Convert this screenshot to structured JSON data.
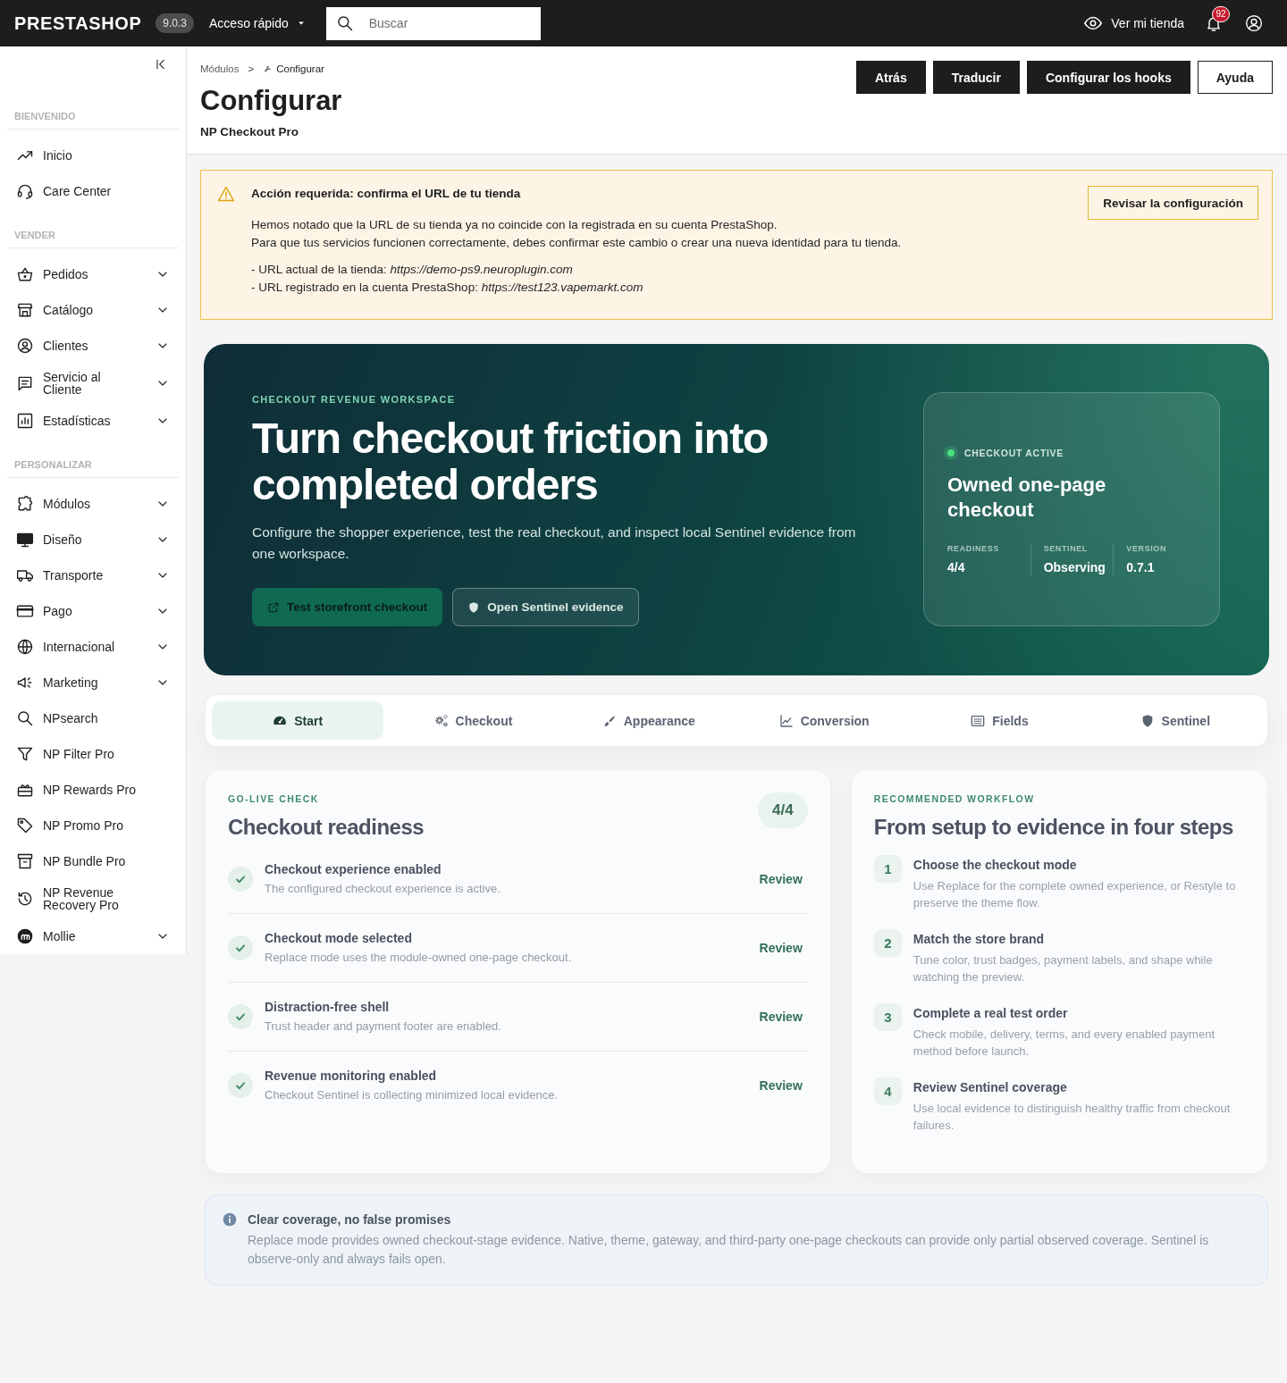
{
  "topbar": {
    "logo": "PRESTASHOP",
    "version": "9.0.3",
    "quick_access": "Acceso rápido",
    "search": {
      "placeholder": "Buscar"
    },
    "view_store": "Ver mi tienda",
    "notifications": "92"
  },
  "sidebar": {
    "sections": [
      {
        "title": "BIENVENIDO",
        "items": [
          {
            "label": "Inicio",
            "has_submenu": false
          },
          {
            "label": "Care Center",
            "has_submenu": false
          }
        ]
      },
      {
        "title": "VENDER",
        "items": [
          {
            "label": "Pedidos",
            "has_submenu": true
          },
          {
            "label": "Catálogo",
            "has_submenu": true
          },
          {
            "label": "Clientes",
            "has_submenu": true
          },
          {
            "label": "Servicio al Cliente",
            "has_submenu": true
          },
          {
            "label": "Estadísticas",
            "has_submenu": true
          }
        ]
      },
      {
        "title": "PERSONALIZAR",
        "items": [
          {
            "label": "Módulos",
            "has_submenu": true
          },
          {
            "label": "Diseño",
            "has_submenu": true
          },
          {
            "label": "Transporte",
            "has_submenu": true
          },
          {
            "label": "Pago",
            "has_submenu": true
          },
          {
            "label": "Internacional",
            "has_submenu": true
          },
          {
            "label": "Marketing",
            "has_submenu": true
          },
          {
            "label": "NPsearch",
            "has_submenu": false
          },
          {
            "label": "NP Filter Pro",
            "has_submenu": false
          },
          {
            "label": "NP Rewards Pro",
            "has_submenu": false
          },
          {
            "label": "NP Promo Pro",
            "has_submenu": false
          },
          {
            "label": "NP Bundle Pro",
            "has_submenu": false
          },
          {
            "label": "NP Revenue Recovery Pro",
            "has_submenu": false
          },
          {
            "label": "Mollie",
            "has_submenu": true
          }
        ]
      }
    ]
  },
  "header": {
    "breadcrumb": {
      "parent": "Módulos",
      "separator": ">",
      "current": "Configurar"
    },
    "title": "Configurar",
    "subtitle": "NP Checkout Pro",
    "buttons": [
      {
        "label": "Atrás",
        "kind": "dark"
      },
      {
        "label": "Traducir",
        "kind": "dark"
      },
      {
        "label": "Configurar los hooks",
        "kind": "dark"
      },
      {
        "label": "Ayuda",
        "kind": "outline"
      }
    ]
  },
  "alert": {
    "title": "Acción requerida: confirma el URL de tu tienda",
    "lines": [
      "Hemos notado que la URL de su tienda ya no coincide con la registrada en su cuenta PrestaShop.",
      "Para que tus servicios funcionen correctamente, debes confirmar este cambio o crear una nueva identidad para tu tienda."
    ],
    "urls": [
      "- URL actual de la tienda: *https://demo-ps9.neuroplugin.com*",
      "- URL registrado en la cuenta PrestaShop: *https://test123.vapemarkt.com*"
    ],
    "button": "Revisar la configuración"
  },
  "hero": {
    "eyebrow": "CHECKOUT REVENUE WORKSPACE",
    "title": "Turn checkout friction into completed orders",
    "text": "Configure the shopper experience, test the real checkout, and inspect local Sentinel evidence from one workspace.",
    "buttons": [
      {
        "label": "Test storefront checkout",
        "kind": "primary"
      },
      {
        "label": "Open Sentinel evidence",
        "kind": "secondary"
      }
    ],
    "status": {
      "label": "CHECKOUT ACTIVE",
      "on": true,
      "title": "Owned one-page checkout",
      "metrics": [
        {
          "label": "READINESS",
          "value": "4/4"
        },
        {
          "label": "SENTINEL",
          "value": "Observing"
        },
        {
          "label": "VERSION",
          "value": "0.7.1"
        }
      ]
    }
  },
  "tabs": [
    {
      "label": "Start",
      "selected": true
    },
    {
      "label": "Checkout",
      "selected": false
    },
    {
      "label": "Appearance",
      "selected": false
    },
    {
      "label": "Conversion",
      "selected": false
    },
    {
      "label": "Fields",
      "selected": false
    },
    {
      "label": "Sentinel",
      "selected": false
    }
  ],
  "readiness": {
    "eyebrow": "GO-LIVE CHECK",
    "title": "Checkout readiness",
    "badge": "4/4",
    "items": [
      {
        "title": "Checkout experience enabled",
        "description": "The configured checkout experience is active.",
        "action": "Review",
        "done": true
      },
      {
        "title": "Checkout mode selected",
        "description": "Replace mode uses the module-owned one-page checkout.",
        "action": "Review",
        "done": true
      },
      {
        "title": "Distraction-free shell",
        "description": "Trust header and payment footer are enabled.",
        "action": "Review",
        "done": true
      },
      {
        "title": "Revenue monitoring enabled",
        "description": "Checkout Sentinel is collecting minimized local evidence.",
        "action": "Review",
        "done": true
      }
    ]
  },
  "workflow": {
    "eyebrow": "RECOMMENDED WORKFLOW",
    "title": "From setup to evidence in four steps",
    "steps": [
      {
        "number": "1",
        "title": "Choose the checkout mode",
        "description": "Use Replace for the complete owned experience, or Restyle to preserve the theme flow."
      },
      {
        "number": "2",
        "title": "Match the store brand",
        "description": "Tune color, trust badges, payment labels, and shape while watching the preview."
      },
      {
        "number": "3",
        "title": "Complete a real test order",
        "description": "Check mobile, delivery, terms, and every enabled payment method before launch."
      },
      {
        "number": "4",
        "title": "Review Sentinel coverage",
        "description": "Use local evidence to distinguish healthy traffic from checkout failures."
      }
    ]
  },
  "note": {
    "title": "Clear coverage, no false promises",
    "text": "Replace mode provides owned checkout-stage evidence. Native, theme, gateway, and third-party one-page checkouts can provide only partial observed coverage. Sentinel is observe-only and always fails open."
  }
}
